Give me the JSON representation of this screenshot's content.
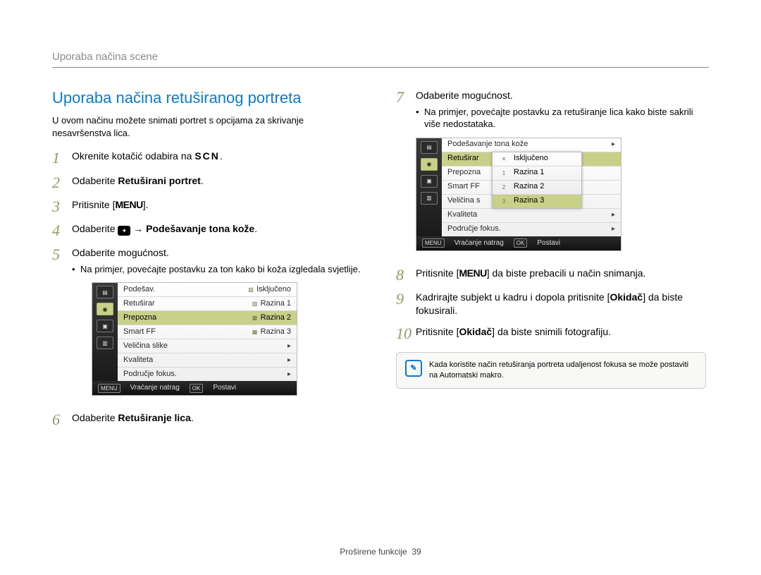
{
  "header": {
    "breadcrumb": "Uporaba načina scene"
  },
  "section": {
    "title": "Uporaba načina retuširanog portreta",
    "intro": "U ovom načinu možete snimati portret s opcijama za skrivanje nesavršenstva lica."
  },
  "steps_left": {
    "s1_prefix": "Okrenite kotačić odabira na ",
    "s1_scn": "SCN",
    "s1_suffix": ".",
    "s2_prefix": "Odaberite ",
    "s2_bold": "Retuširani portret",
    "s2_suffix": ".",
    "s3_prefix": "Pritisnite [",
    "s3_menu": "MENU",
    "s3_suffix": "].",
    "s4_prefix": "Odaberite ",
    "s4_arrow": " → ",
    "s4_bold": "Podešavanje tona kože",
    "s4_suffix": ".",
    "s5": "Odaberite mogućnost.",
    "s5_bullet": "Na primjer, povećajte postavku za ton kako bi koža izgledala svjetlije.",
    "s6_prefix": "Odaberite ",
    "s6_bold": "Retuširanje lica",
    "s6_suffix": "."
  },
  "steps_right": {
    "s7": "Odaberite mogućnost.",
    "s7_bullet": "Na primjer, povećajte postavku za retuširanje lica kako biste sakrili više nedostataka.",
    "s8_prefix": "Pritisnite [",
    "s8_menu": "MENU",
    "s8_suffix": "] da biste prebacili u način snimanja.",
    "s9_prefix": "Kadrirajte subjekt u kadru i dopola pritisnite [",
    "s9_bold": "Okidač",
    "s9_suffix": "] da biste fokusirali.",
    "s10_prefix": "Pritisnite [",
    "s10_bold": "Okidač",
    "s10_suffix": "] da biste snimili fotografiju."
  },
  "lcd1": {
    "title": "Podešav.",
    "rows": [
      {
        "label": "Retuširar",
        "val": "Razina 1"
      },
      {
        "label": "Prepozna",
        "val": "Razina 2",
        "hl": true
      },
      {
        "label": "Smart FF",
        "val": "Razina 3"
      },
      {
        "label": "Veličina slike",
        "right": "▶"
      },
      {
        "label": "Kvaliteta",
        "right": "▶"
      },
      {
        "label": "Područje fokus.",
        "right": "▶"
      }
    ],
    "title_val": "Isključeno",
    "foot_back": "Vraćanje natrag",
    "foot_set": "Postavi"
  },
  "lcd2": {
    "title": "Podešavanje tona kože",
    "rows": [
      {
        "label": "Retuširar"
      },
      {
        "label": "Prepozna"
      },
      {
        "label": "Smart FF"
      },
      {
        "label": "Veličina s"
      },
      {
        "label": "Kvaliteta",
        "right": "▶"
      },
      {
        "label": "Područje fokus.",
        "right": "▶"
      }
    ],
    "popup": [
      {
        "label": "Isključeno"
      },
      {
        "label": "Razina 1"
      },
      {
        "label": "Razina 2"
      },
      {
        "label": "Razina 3",
        "hl": true
      }
    ],
    "foot_back": "Vraćanje natrag",
    "foot_set": "Postavi"
  },
  "note": {
    "text": "Kada koristite način retuširanja portreta udaljenost fokusa se može postaviti na Automatski makro."
  },
  "footer": {
    "section": "Proširene funkcije",
    "page": "39"
  }
}
